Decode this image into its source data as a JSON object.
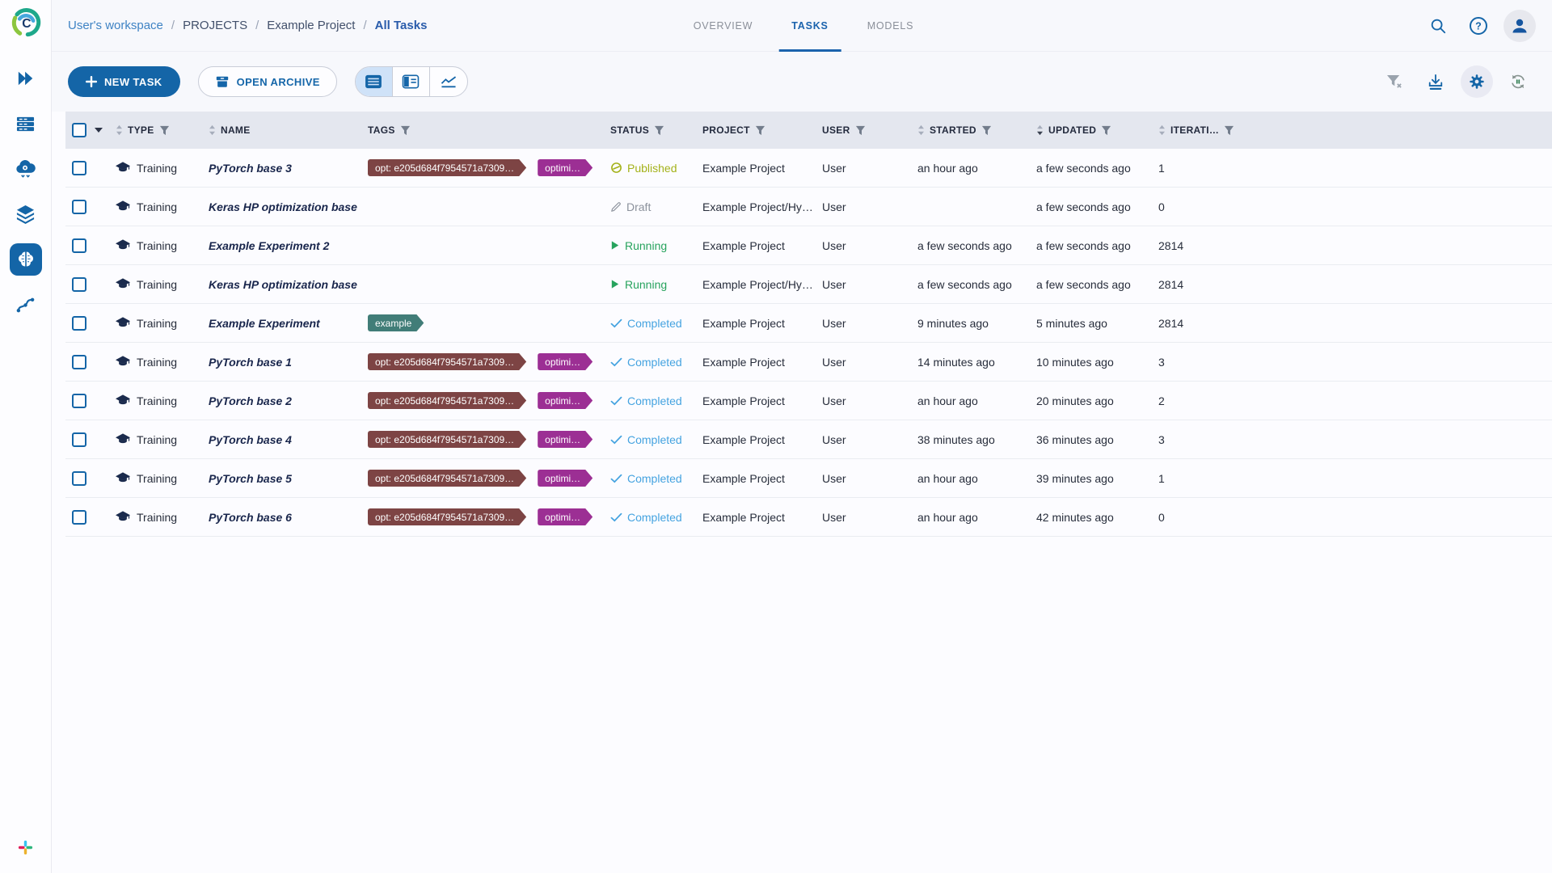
{
  "colors": {
    "primary_blue": "#1465a7",
    "topbar_bg": "#f7f8fc",
    "header_band_bg": "#e4e7ef",
    "row_bg": "#fcfcff",
    "toggle_active_bg": "#cfe2f8"
  },
  "breadcrumb": {
    "items": [
      "User's workspace",
      "PROJECTS",
      "Example Project",
      "All Tasks"
    ],
    "separator": "/"
  },
  "tabs": [
    {
      "label": "OVERVIEW",
      "active": false
    },
    {
      "label": "TASKS",
      "active": true
    },
    {
      "label": "MODELS",
      "active": false
    }
  ],
  "toolbar": {
    "new_task": "NEW TASK",
    "open_archive": "OPEN ARCHIVE"
  },
  "statuses": {
    "Published": "#a4b21a",
    "Draft": "#8b919c",
    "Running": "#27a35d",
    "Completed": "#45a3e0"
  },
  "tag_colors": {
    "opt": "#7d4444",
    "optimi": "#9c2f94",
    "example": "#417d78"
  },
  "table": {
    "columns": [
      {
        "key": "type",
        "label": "TYPE",
        "sort": "none",
        "filter": true
      },
      {
        "key": "name",
        "label": "NAME",
        "sort": "none",
        "filter": false
      },
      {
        "key": "tags",
        "label": "TAGS",
        "sort": null,
        "filter": true
      },
      {
        "key": "status",
        "label": "STATUS",
        "sort": null,
        "filter": true
      },
      {
        "key": "project",
        "label": "PROJECT",
        "sort": null,
        "filter": true
      },
      {
        "key": "user",
        "label": "USER",
        "sort": null,
        "filter": true
      },
      {
        "key": "started",
        "label": "STARTED",
        "sort": "none",
        "filter": true
      },
      {
        "key": "updated",
        "label": "UPDATED",
        "sort": "desc",
        "filter": true
      },
      {
        "key": "iterations",
        "label": "ITERATI…",
        "sort": "none",
        "filter": true
      }
    ],
    "rows": [
      {
        "type": "Training",
        "name": "PyTorch base 3",
        "tags": [
          {
            "text": "opt: e205d684f7954571a7309…",
            "color_key": "opt"
          },
          {
            "text": "optimi…",
            "color_key": "optimi"
          }
        ],
        "status": "Published",
        "project": "Example Project",
        "user": "User",
        "started": "an hour ago",
        "updated": "a few seconds ago",
        "iterations": "1"
      },
      {
        "type": "Training",
        "name": "Keras HP optimization base",
        "tags": [],
        "status": "Draft",
        "project": "Example Project/Hy…",
        "user": "User",
        "started": "",
        "updated": "a few seconds ago",
        "iterations": "0"
      },
      {
        "type": "Training",
        "name": "Example Experiment 2",
        "tags": [],
        "status": "Running",
        "project": "Example Project",
        "user": "User",
        "started": "a few seconds ago",
        "updated": "a few seconds ago",
        "iterations": "2814"
      },
      {
        "type": "Training",
        "name": "Keras HP optimization base",
        "tags": [],
        "status": "Running",
        "project": "Example Project/Hy…",
        "user": "User",
        "started": "a few seconds ago",
        "updated": "a few seconds ago",
        "iterations": "2814"
      },
      {
        "type": "Training",
        "name": "Example Experiment",
        "tags": [
          {
            "text": "example",
            "color_key": "example"
          }
        ],
        "status": "Completed",
        "project": "Example Project",
        "user": "User",
        "started": "9 minutes ago",
        "updated": "5 minutes ago",
        "iterations": "2814"
      },
      {
        "type": "Training",
        "name": "PyTorch base 1",
        "tags": [
          {
            "text": "opt: e205d684f7954571a7309…",
            "color_key": "opt"
          },
          {
            "text": "optimi…",
            "color_key": "optimi"
          }
        ],
        "status": "Completed",
        "project": "Example Project",
        "user": "User",
        "started": "14 minutes ago",
        "updated": "10 minutes ago",
        "iterations": "3"
      },
      {
        "type": "Training",
        "name": "PyTorch base 2",
        "tags": [
          {
            "text": "opt: e205d684f7954571a7309…",
            "color_key": "opt"
          },
          {
            "text": "optimi…",
            "color_key": "optimi"
          }
        ],
        "status": "Completed",
        "project": "Example Project",
        "user": "User",
        "started": "an hour ago",
        "updated": "20 minutes ago",
        "iterations": "2"
      },
      {
        "type": "Training",
        "name": "PyTorch base 4",
        "tags": [
          {
            "text": "opt: e205d684f7954571a7309…",
            "color_key": "opt"
          },
          {
            "text": "optimi…",
            "color_key": "optimi"
          }
        ],
        "status": "Completed",
        "project": "Example Project",
        "user": "User",
        "started": "38 minutes ago",
        "updated": "36 minutes ago",
        "iterations": "3"
      },
      {
        "type": "Training",
        "name": "PyTorch base 5",
        "tags": [
          {
            "text": "opt: e205d684f7954571a7309…",
            "color_key": "opt"
          },
          {
            "text": "optimi…",
            "color_key": "optimi"
          }
        ],
        "status": "Completed",
        "project": "Example Project",
        "user": "User",
        "started": "an hour ago",
        "updated": "39 minutes ago",
        "iterations": "1"
      },
      {
        "type": "Training",
        "name": "PyTorch base 6",
        "tags": [
          {
            "text": "opt: e205d684f7954571a7309…",
            "color_key": "opt"
          },
          {
            "text": "optimi…",
            "color_key": "optimi"
          }
        ],
        "status": "Completed",
        "project": "Example Project",
        "user": "User",
        "started": "an hour ago",
        "updated": "42 minutes ago",
        "iterations": "0"
      }
    ]
  }
}
